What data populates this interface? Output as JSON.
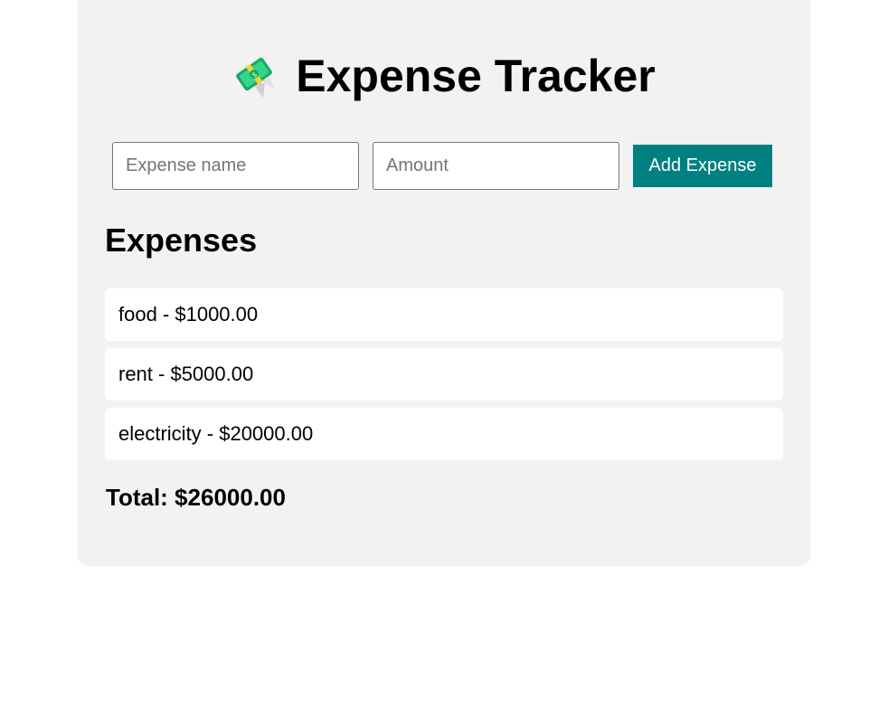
{
  "header": {
    "icon": "money-with-wings-icon",
    "title": "Expense Tracker"
  },
  "form": {
    "name_placeholder": "Expense name",
    "name_value": "",
    "amount_placeholder": "Amount",
    "amount_value": "",
    "add_label": "Add Expense"
  },
  "expenses": {
    "heading": "Expenses",
    "items": [
      {
        "label": "food - $1000.00"
      },
      {
        "label": "rent - $5000.00"
      },
      {
        "label": "electricity - $20000.00"
      }
    ],
    "total_label": "Total: $26000.00"
  },
  "colors": {
    "accent": "#008080",
    "card_bg": "#f2f2f2",
    "item_bg": "#ffffff"
  }
}
